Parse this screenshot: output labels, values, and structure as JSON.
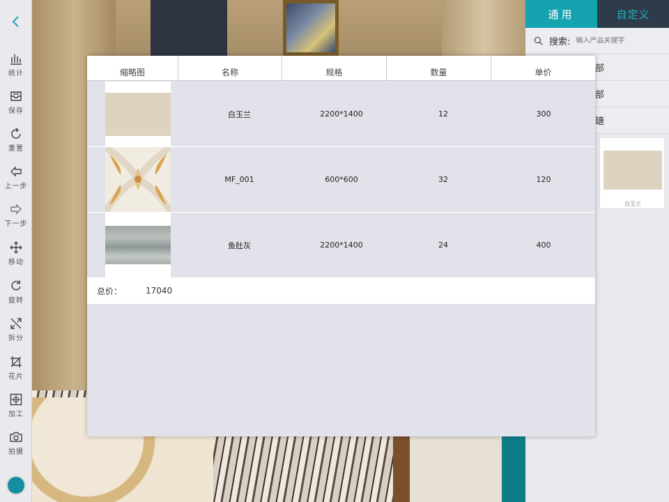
{
  "toolbar": {
    "items": [
      {
        "label": "统计",
        "icon": "bar-chart-icon"
      },
      {
        "label": "保存",
        "icon": "save-icon"
      },
      {
        "label": "重置",
        "icon": "reset-icon"
      },
      {
        "label": "上一步",
        "icon": "undo-icon"
      },
      {
        "label": "下一步",
        "icon": "redo-icon"
      },
      {
        "label": "移动",
        "icon": "move-icon"
      },
      {
        "label": "旋转",
        "icon": "rotate-icon"
      },
      {
        "label": "拆分",
        "icon": "split-icon"
      },
      {
        "label": "花片",
        "icon": "crop-icon"
      },
      {
        "label": "加工",
        "icon": "process-icon"
      },
      {
        "label": "拍摄",
        "icon": "camera-icon"
      }
    ]
  },
  "right_panel": {
    "tabs": [
      "通用",
      "自定义"
    ],
    "search": {
      "label": "搜索:",
      "placeholder": "输入产品关键字"
    },
    "categories": [
      "部",
      "部",
      "瑭"
    ],
    "product": {
      "name": "白玉兰"
    }
  },
  "dialog": {
    "columns": [
      "缩略图",
      "名称",
      "规格",
      "数量",
      "单价"
    ],
    "rows": [
      {
        "name": "白玉兰",
        "spec": "2200*1400",
        "qty": "12",
        "price": "300"
      },
      {
        "name": "MF_001",
        "spec": "600*600",
        "qty": "32",
        "price": "120"
      },
      {
        "name": "鱼肚灰",
        "spec": "2200*1400",
        "qty": "24",
        "price": "400"
      }
    ],
    "total_label": "总价：",
    "total_value": "17040"
  },
  "colors": {
    "accent": "#16a3b0",
    "tab_dark": "#2d3b4a",
    "toolbar_bg": "#e9e9ee"
  }
}
